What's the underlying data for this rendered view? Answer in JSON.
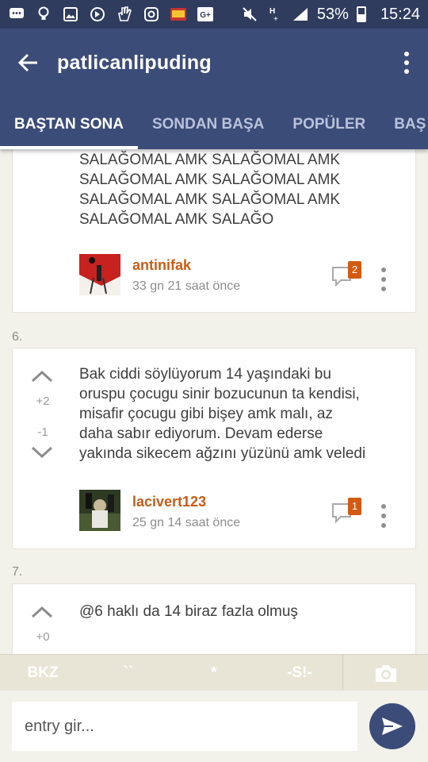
{
  "status_bar": {
    "battery": "53%",
    "time": "15:24",
    "icons": [
      "chat-icon",
      "lightbulb-icon",
      "image-icon",
      "sync-icon",
      "hand-icon",
      "instagram-icon",
      "tv-icon",
      "google-plus-icon",
      "mute-icon",
      "hplus-icon",
      "signal-icon",
      "battery-icon"
    ]
  },
  "toolbar": {
    "title": "patlicanlipuding",
    "back_icon": "arrow-left-icon",
    "menu_icon": "vertical-dots-icon"
  },
  "tabs": [
    "BAŞTAN SONA",
    "SONDAN BAŞA",
    "POPÜLER",
    "BAŞ"
  ],
  "entries": [
    {
      "lines": [
        "SALAĞOMAL AMK SALAĞOMAL AMK",
        "SALAĞOMAL AMK SALAĞOMAL AMK",
        "SALAĞOMAL AMK SALAĞOMAL AMK",
        "SALAĞOMAL AMK SALAĞO"
      ],
      "author": "antinifak",
      "time": "33 gn 21 saat  önce",
      "comments": "2"
    },
    {
      "number": "6.",
      "lines": [
        "Bak ciddi söylüyorum 14 yaşındaki bu",
        "oruspu çocugu sinir bozucunun ta kendisi,",
        "misafir çocugu gibi bişey amk malı, az",
        "daha sabır ediyorum. Devam ederse",
        "yakında sikecem ağzını yüzünü amk veledi"
      ],
      "votes_up": "+2",
      "votes_down": "-1",
      "author": "lacivert123",
      "time": "25 gn 14 saat  önce",
      "comments": "1"
    },
    {
      "number": "7.",
      "lines": [
        "@6 haklı da 14 biraz fazla olmuş"
      ],
      "votes_up": "+0"
    }
  ],
  "format_bar": {
    "buttons": [
      "BKZ",
      "``",
      "*",
      "-S!-"
    ],
    "camera_icon": "camera-icon"
  },
  "input": {
    "placeholder": "entry gir...",
    "send_icon": "send-icon"
  },
  "colors": {
    "primary": "#3c4c78",
    "status_bar": "#2f3c5e",
    "author": "#c45d17",
    "badge": "#d35a12",
    "background": "#f2f1ea"
  }
}
